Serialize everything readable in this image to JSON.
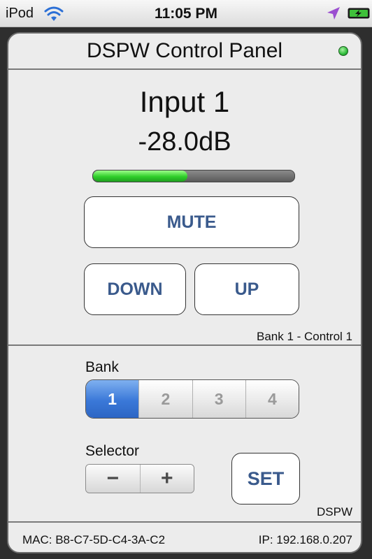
{
  "status_bar": {
    "carrier": "iPod",
    "time": "11:05 PM",
    "wifi_icon": "wifi-icon",
    "location_icon": "location-arrow-icon",
    "battery_icon": "battery-charging-icon"
  },
  "panel": {
    "title": "DSPW Control Panel",
    "status_led_color": "#2ebc3a",
    "input_name": "Input 1",
    "level_db": "-28.0dB",
    "level_fraction": 0.47,
    "mute_label": "MUTE",
    "down_label": "DOWN",
    "up_label": "UP",
    "bank_control": "Bank 1 - Control 1",
    "bank_label": "Bank",
    "banks": [
      "1",
      "2",
      "3",
      "4"
    ],
    "selected_bank": "1",
    "selector_label": "Selector",
    "minus_label": "−",
    "plus_label": "+",
    "set_label": "SET",
    "brand": "DSPW",
    "mac": "MAC: B8-C7-5D-C4-3A-C2",
    "ip": "IP: 192.168.0.207"
  },
  "colors": {
    "accent_blue": "#3a78d8",
    "button_text": "#3a5a8c",
    "meter_green": "#2fce2a"
  }
}
